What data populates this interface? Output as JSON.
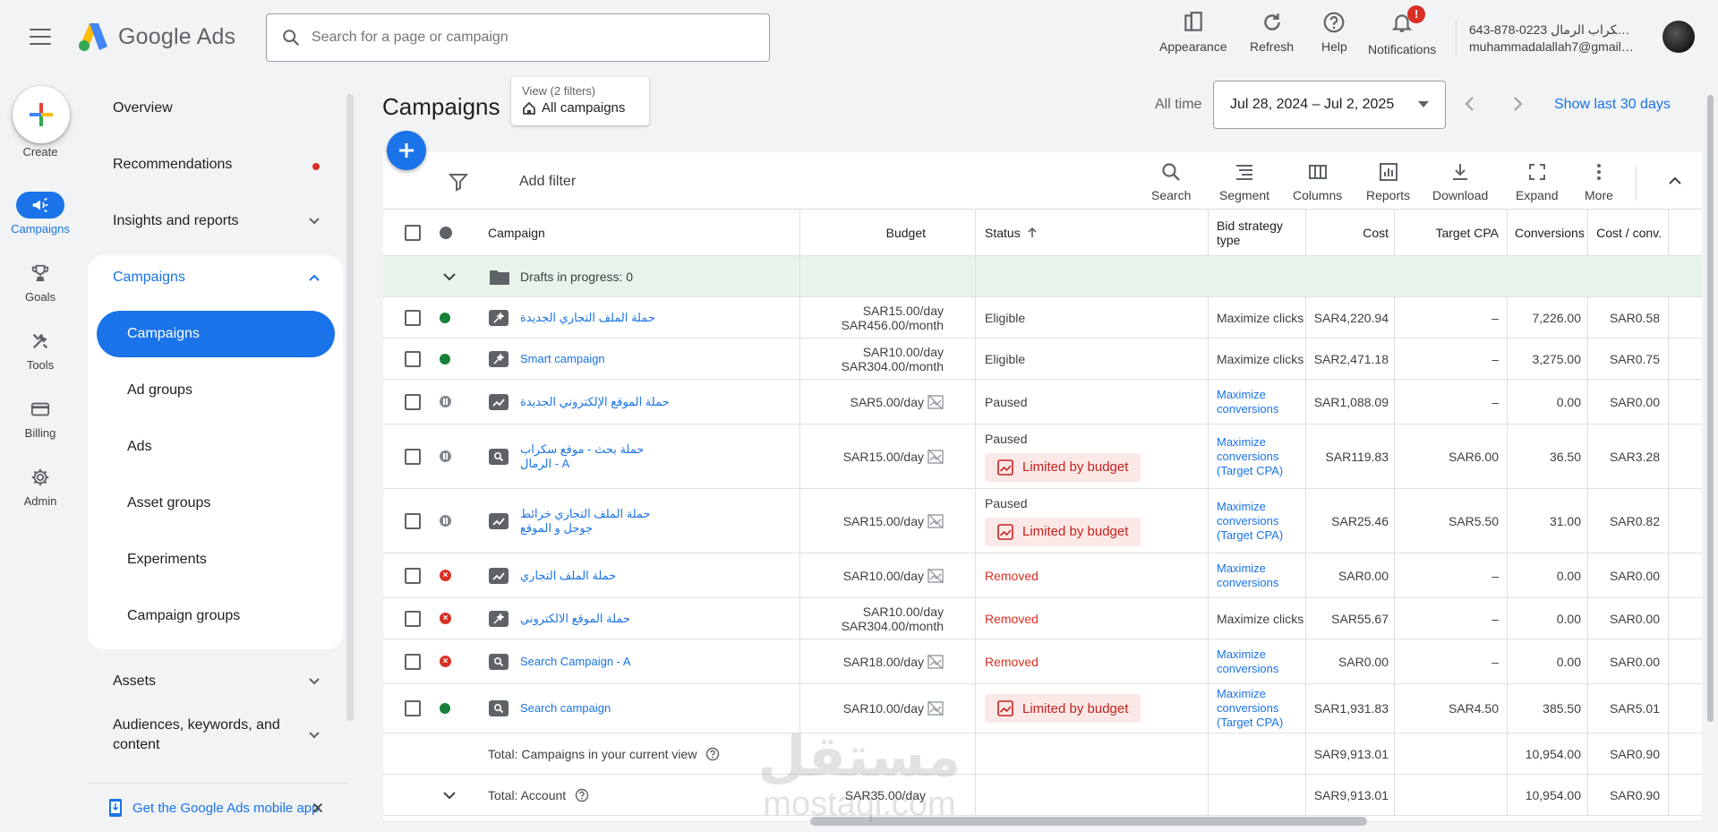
{
  "header": {
    "app_name": "Google Ads",
    "search_placeholder": "Search for a page or campaign",
    "actions": {
      "appearance": "Appearance",
      "refresh": "Refresh",
      "help": "Help",
      "notifications": "Notifications",
      "notification_badge": "!"
    },
    "account": {
      "name": "643-878-0223 سكراب الرمال - scra...",
      "email": "muhammadalallah7@gmail.co..."
    }
  },
  "rail": {
    "create": "Create",
    "items": [
      {
        "label": "Campaigns",
        "icon": "megaphone-icon"
      },
      {
        "label": "Goals",
        "icon": "trophy-icon"
      },
      {
        "label": "Tools",
        "icon": "tools-icon"
      },
      {
        "label": "Billing",
        "icon": "credit-card-icon"
      },
      {
        "label": "Admin",
        "icon": "gear-icon"
      }
    ]
  },
  "sidenav": {
    "overview": "Overview",
    "recommendations": "Recommendations",
    "insights": "Insights and reports",
    "campaigns_group": "Campaigns",
    "sub": [
      "Campaigns",
      "Ad groups",
      "Ads",
      "Asset groups",
      "Experiments",
      "Campaign groups"
    ],
    "assets": "Assets",
    "audiences": "Audiences, keywords, and content",
    "mobile_app": "Get the Google Ads mobile app"
  },
  "main": {
    "title": "Campaigns",
    "view_line1": "View (2 filters)",
    "view_line2": "All campaigns",
    "all_time": "All time",
    "date_range": "Jul 28, 2024 – Jul 2, 2025",
    "show_last": "Show last 30 days"
  },
  "toolbar": {
    "add_filter": "Add filter",
    "buttons": [
      "Search",
      "Segment",
      "Columns",
      "Reports",
      "Download",
      "Expand",
      "More"
    ]
  },
  "table": {
    "headers": {
      "campaign": "Campaign",
      "budget": "Budget",
      "status": "Status",
      "bid_strategy": "Bid strategy type",
      "cost": "Cost",
      "target_cpa": "Target CPA",
      "conversions": "Conversions",
      "cost_conv": "Cost / conv."
    },
    "drafts": "Drafts in progress: 0",
    "limited_label": "Limited by budget",
    "rows": [
      {
        "name": "حملة الملف التجاري الجديدة",
        "budget1": "SAR15.00/day",
        "budget2": "SAR456.00/month",
        "status": "Eligible",
        "bid": "Maximize clicks",
        "cost": "SAR4,220.94",
        "tcpa": "–",
        "conv": "7,226.00",
        "cpc": "SAR0.58"
      },
      {
        "name": "Smart campaign",
        "budget1": "SAR10.00/day",
        "budget2": "SAR304.00/month",
        "status": "Eligible",
        "bid": "Maximize clicks",
        "cost": "SAR2,471.18",
        "tcpa": "–",
        "conv": "3,275.00",
        "cpc": "SAR0.75"
      },
      {
        "name": "حملة الموقع الإلكتروني الجديدة",
        "budget1": "SAR5.00/day",
        "status": "Paused",
        "bid": "Maximize conversions",
        "cost": "SAR1,088.09",
        "tcpa": "–",
        "conv": "0.00",
        "cpc": "SAR0.00"
      },
      {
        "name": "حملة بحث - موقع سكراب الرمال - A",
        "budget1": "SAR15.00/day",
        "status": "Paused",
        "bid": "Maximize conversions (Target CPA)",
        "cost": "SAR119.83",
        "tcpa": "SAR6.00",
        "conv": "36.50",
        "cpc": "SAR3.28"
      },
      {
        "name": "حملة الملف التجاري خرائط جوجل و الموقع",
        "budget1": "SAR15.00/day",
        "status": "Paused",
        "bid": "Maximize conversions (Target CPA)",
        "cost": "SAR25.46",
        "tcpa": "SAR5.50",
        "conv": "31.00",
        "cpc": "SAR0.82"
      },
      {
        "name": "حملة الملف التجاري",
        "budget1": "SAR10.00/day",
        "status": "Removed",
        "bid": "Maximize conversions",
        "cost": "SAR0.00",
        "tcpa": "–",
        "conv": "0.00",
        "cpc": "SAR0.00"
      },
      {
        "name": "حملة الموقع الالكتروني",
        "budget1": "SAR10.00/day",
        "budget2": "SAR304.00/month",
        "status": "Removed",
        "bid": "Maximize clicks",
        "cost": "SAR55.67",
        "tcpa": "–",
        "conv": "0.00",
        "cpc": "SAR0.00"
      },
      {
        "name": "Search Campaign - A",
        "budget1": "SAR18.00/day",
        "status": "Removed",
        "bid": "Maximize conversions",
        "cost": "SAR0.00",
        "tcpa": "–",
        "conv": "0.00",
        "cpc": "SAR0.00"
      },
      {
        "name": "Search campaign",
        "budget1": "SAR10.00/day",
        "status": "Limited by budget",
        "bid": "Maximize conversions (Target CPA)",
        "cost": "SAR1,931.83",
        "tcpa": "SAR4.50",
        "conv": "385.50",
        "cpc": "SAR5.01"
      }
    ],
    "total_view": {
      "label": "Total: Campaigns in your current view",
      "cost": "SAR9,913.01",
      "conv": "10,954.00",
      "cpc": "SAR0.90"
    },
    "total_account": {
      "label": "Total: Account",
      "budget": "SAR35.00/day",
      "cost": "SAR9,913.01",
      "conv": "10,954.00",
      "cpc": "SAR0.90"
    }
  },
  "watermark": {
    "line1": "مستقل",
    "line2": "mostaql.com"
  },
  "colors": {
    "accent": "#1a73e8",
    "eligible": "#188038",
    "removed": "#d93025",
    "limited_bg": "#fce8e6",
    "drafts_bg": "#e6f4ea"
  }
}
